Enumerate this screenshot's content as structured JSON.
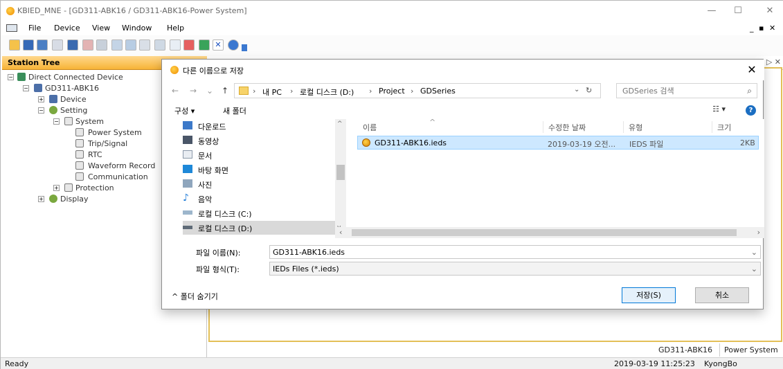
{
  "window": {
    "title": "KBIED_MNE - [GD311-ABK16 / GD311-ABK16-Power System]",
    "minimize": "—",
    "maximize": "☐",
    "close": "✕"
  },
  "menu": {
    "items": [
      "File",
      "Device",
      "View",
      "Window",
      "Help"
    ],
    "mdi_controls": "_ ▪ ✕"
  },
  "station_tree": {
    "header": "Station Tree",
    "nodes": [
      {
        "label": "Direct Connected Device",
        "icon": "network-icon"
      },
      {
        "label": "GD311-ABK16",
        "icon": "device-icon"
      },
      {
        "label": "Device",
        "icon": "device-icon"
      },
      {
        "label": "Setting",
        "icon": "gears-icon"
      },
      {
        "label": "System",
        "icon": "pencil-page-icon"
      },
      {
        "label": "Power System",
        "icon": "pencil-page-icon"
      },
      {
        "label": "Trip/Signal",
        "icon": "pencil-page-icon"
      },
      {
        "label": "RTC",
        "icon": "pencil-page-icon"
      },
      {
        "label": "Waveform Record",
        "icon": "pencil-page-icon"
      },
      {
        "label": "Communication",
        "icon": "pencil-page-icon"
      },
      {
        "label": "Protection",
        "icon": "pencil-page-icon"
      },
      {
        "label": "Display",
        "icon": "gears-icon"
      }
    ]
  },
  "bottom_tabs": [
    "GD311-ABK16",
    "Power System"
  ],
  "statusbar": {
    "left": "Ready",
    "datetime": "2019-03-19 11:25:23",
    "user": "KyongBo"
  },
  "dialog": {
    "title": "다른 이름으로 저장",
    "close": "✕",
    "breadcrumb": [
      "내 PC",
      "로컬 디스크 (D:)",
      "Project",
      "GDSeries"
    ],
    "search_placeholder": "GDSeries 검색",
    "organize": "구성 ▾",
    "new_folder": "새 폴더",
    "nav_items": [
      {
        "label": "다운로드",
        "icon": "download-icon"
      },
      {
        "label": "동영상",
        "icon": "video-icon"
      },
      {
        "label": "문서",
        "icon": "document-icon"
      },
      {
        "label": "바탕 화면",
        "icon": "desktop-icon"
      },
      {
        "label": "사진",
        "icon": "picture-icon"
      },
      {
        "label": "음악",
        "icon": "music-icon"
      },
      {
        "label": "로컬 디스크 (C:)",
        "icon": "drive-icon"
      },
      {
        "label": "로컬 디스크 (D:)",
        "icon": "drive-icon"
      }
    ],
    "columns": [
      "이름",
      "수정한 날짜",
      "유형",
      "크기"
    ],
    "file": {
      "name": "GD311-ABK16.ieds",
      "modified": "2019-03-19 오전...",
      "type": "IEDS 파일",
      "size": "2KB"
    },
    "filename_label": "파일 이름(N):",
    "filename_value": "GD311-ABK16.ieds",
    "filetype_label": "파일 형식(T):",
    "filetype_value": "IEDs Files (*.ieds)",
    "hide_folders": "폴더 숨기기",
    "save_button": "저장(S)",
    "cancel_button": "취소"
  },
  "colors": {
    "station_header": "#f7b337",
    "selection": "#cde8ff",
    "accent": "#0078d7"
  }
}
